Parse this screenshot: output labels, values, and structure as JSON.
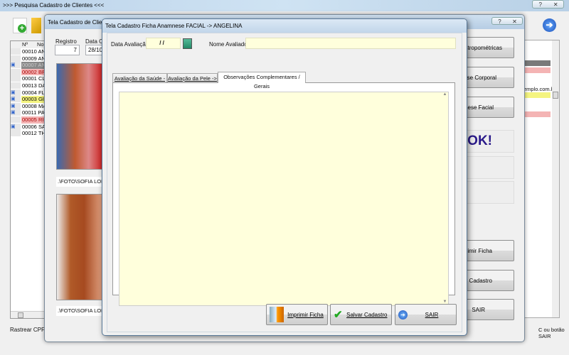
{
  "outer_window": {
    "title": ">>> Pesquisa Cadastro de Clientes <<<",
    "list_headers": [
      "Nº",
      "Nome"
    ],
    "rows": [
      {
        "id": "00010",
        "name": "ANA",
        "style": "normal",
        "icon": false
      },
      {
        "id": "00009",
        "name": "ANA",
        "style": "normal",
        "icon": false
      },
      {
        "id": "00007",
        "name": "AND",
        "style": "selected",
        "icon": true
      },
      {
        "id": "00002",
        "name": "BRI",
        "style": "pink",
        "icon": false
      },
      {
        "id": "00001",
        "name": "CLI",
        "style": "normal",
        "icon": false
      },
      {
        "id": "00013",
        "name": "DAV",
        "style": "normal",
        "icon": false
      },
      {
        "id": "00004",
        "name": "FLA",
        "style": "normal",
        "icon": true
      },
      {
        "id": "00003",
        "name": "GIS",
        "style": "yellow",
        "icon": true
      },
      {
        "id": "00008",
        "name": "MAR",
        "style": "normal",
        "icon": true
      },
      {
        "id": "00011",
        "name": "PAN",
        "style": "normal",
        "icon": true
      },
      {
        "id": "00005",
        "name": "RIC",
        "style": "pink",
        "icon": false
      },
      {
        "id": "00006",
        "name": "SAR",
        "style": "normal",
        "icon": true
      },
      {
        "id": "00012",
        "name": "THE",
        "style": "normal",
        "icon": false
      }
    ],
    "rastrear_label": "Rastrear CPF",
    "email_fragment": "emplo.com.br",
    "hint_fragment": "C ou botão SAIR",
    "help": "?",
    "close": "✕"
  },
  "client_window": {
    "title": "Tela Cadastro de Clientes",
    "registro_label": "Registro",
    "registro_value": "7",
    "data_label": "Data Ca",
    "data_value": "28/10",
    "photo_path_1": ".\\FOTO\\SOFIA LOREN",
    "photo_path_2": ".\\FOTO\\SOFIA LOREN",
    "buttons": [
      "s Antropométricas",
      "mnese Corporal",
      "mnese Facial"
    ],
    "status_text": "A OK!",
    "bottom_buttons": [
      "primir Ficha",
      "var Cadastro",
      "SAIR"
    ],
    "help": "?",
    "close": "✕"
  },
  "dialog": {
    "title": "Tela Cadastro Ficha Anamnese FACIAL -> ANGELINA",
    "data_avaliacao_label": "Data Avaliação:",
    "data_avaliacao_value": " / /",
    "nome_avaliador_label": "Nome Avaliador:",
    "nome_avaliador_value": "",
    "tabs": [
      "Avaliação da Saúde ->",
      "Avaliação da Pele ->",
      "Observações Complementares / Gerais"
    ],
    "memo_value": "",
    "buttons": {
      "print": "Imprimir Ficha",
      "save": "Salvar Cadastro",
      "exit": "SAIR"
    }
  },
  "colors": {
    "memo_bg": "#ffffdc",
    "pink_row": "#f4b4b4",
    "yellow_row": "#f4f480",
    "selected_row": "#8a8a8a",
    "status_text": "#2a1a8a"
  }
}
